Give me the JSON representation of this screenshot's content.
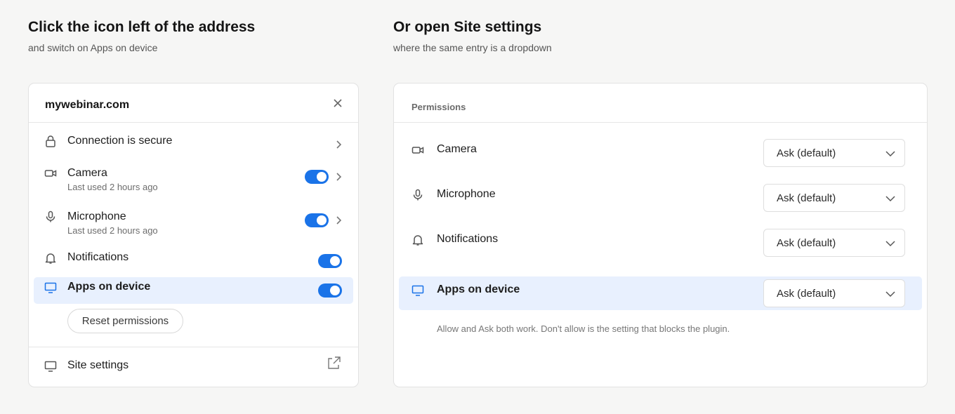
{
  "left_heading": {
    "title": "Click the icon left of the address",
    "subtitle": "and switch on Apps on device"
  },
  "right_heading": {
    "title": "Or open Site settings",
    "subtitle": "where the same entry is a dropdown"
  },
  "site_panel": {
    "site_name": "mywebinar.com",
    "connection": "Connection is secure",
    "items": [
      {
        "label": "Camera",
        "sub": "Last used 2 hours ago",
        "enabled": true
      },
      {
        "label": "Microphone",
        "sub": "Last used 2 hours ago",
        "enabled": true
      },
      {
        "label": "Notifications",
        "enabled": true
      },
      {
        "label": "Apps on device",
        "enabled": true
      }
    ],
    "reset_label": "Reset permissions",
    "site_settings": "Site settings"
  },
  "permissions_panel": {
    "header": "Permissions",
    "rows": [
      {
        "label": "Camera",
        "value": "Ask (default)"
      },
      {
        "label": "Microphone",
        "value": "Ask (default)"
      },
      {
        "label": "Notifications",
        "value": "Ask (default)"
      },
      {
        "label": "Apps on device",
        "value": "Ask (default)"
      }
    ],
    "note": "Allow and Ask both work. Don't allow is the setting that blocks the plugin."
  },
  "colors": {
    "accent": "#1a73e8",
    "highlight": "#e8f0fe",
    "background": "#f6f6f5"
  }
}
